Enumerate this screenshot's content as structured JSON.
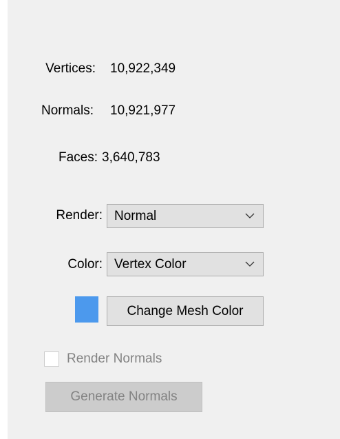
{
  "stats": {
    "vertices_label": "Vertices:",
    "vertices_value": "10,922,349",
    "normals_label": "Normals:",
    "normals_value": "10,921,977",
    "faces_label": "Faces:",
    "faces_value": "3,640,783"
  },
  "render": {
    "label": "Render:",
    "selected": "Normal"
  },
  "color": {
    "label": "Color:",
    "selected": "Vertex Color"
  },
  "mesh_color": {
    "swatch_color": "#4c99ed",
    "button_label": "Change Mesh Color"
  },
  "render_normals": {
    "label": "Render Normals",
    "checked": false,
    "enabled": false
  },
  "generate_normals": {
    "label": "Generate Normals",
    "enabled": false
  },
  "icons": {
    "dropdown": "chevron-down-icon"
  }
}
